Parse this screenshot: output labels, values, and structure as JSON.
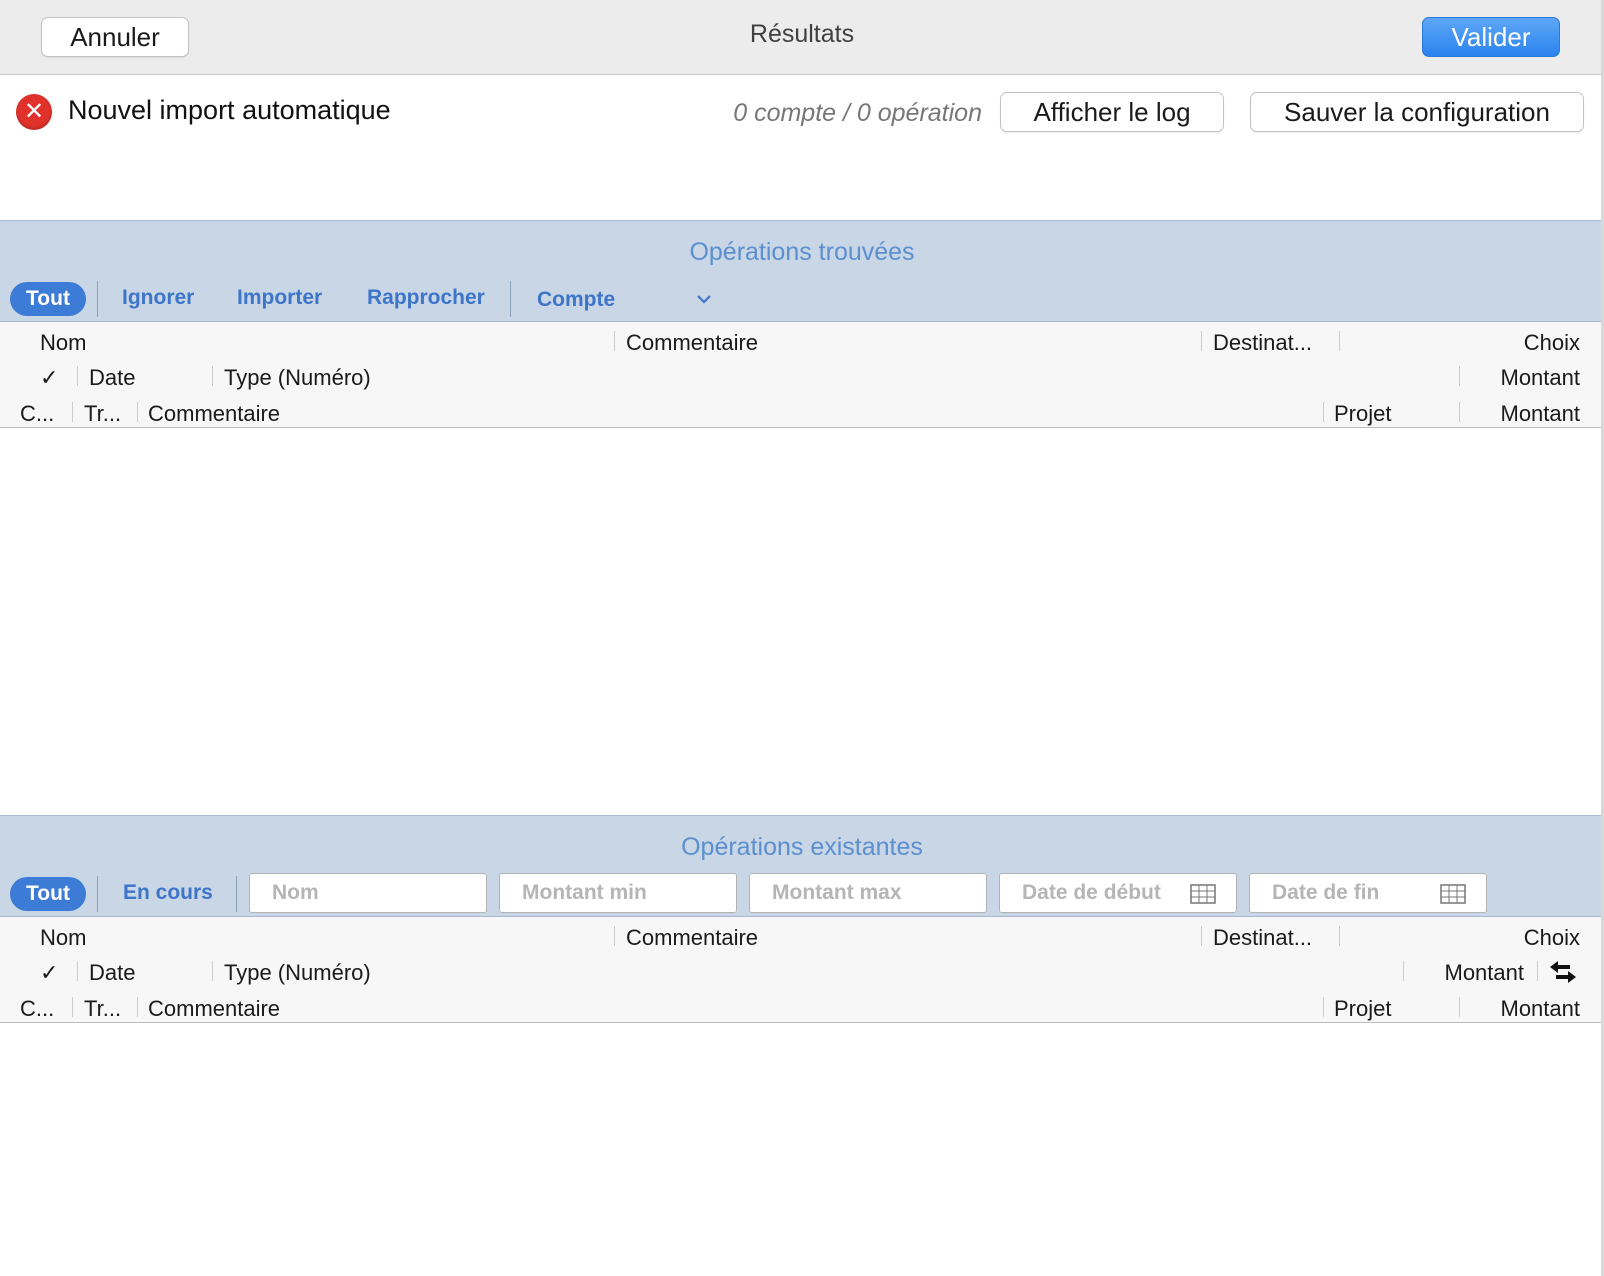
{
  "window": {
    "title": "Résultats",
    "cancel_label": "Annuler",
    "validate_label": "Valider",
    "accent_color": "#2b83ee"
  },
  "import": {
    "status_icon": "error-circle-icon",
    "title": "Nouvel import automatique",
    "counts": "0 compte / 0 opération",
    "show_log_label": "Afficher le log",
    "save_config_label": "Sauver la configuration"
  },
  "found": {
    "title": "Opérations trouvées",
    "filters": [
      "Tout",
      "Ignorer",
      "Importer",
      "Rapprocher"
    ],
    "account_label": "Compte",
    "columns": {
      "row1": [
        "Nom",
        "Commentaire",
        "Destinat...",
        "Choix"
      ],
      "row2": [
        "✓",
        "Date",
        "Type (Numéro)",
        "Montant"
      ],
      "row3": [
        "C...",
        "Tr...",
        "Commentaire",
        "Projet",
        "Montant"
      ]
    }
  },
  "existing": {
    "title": "Opérations existantes",
    "filters": [
      "Tout",
      "En cours"
    ],
    "fields": {
      "name_placeholder": "Nom",
      "min_placeholder": "Montant min",
      "max_placeholder": "Montant max",
      "start_placeholder": "Date de début",
      "end_placeholder": "Date de fin"
    },
    "columns": {
      "row1": [
        "Nom",
        "Commentaire",
        "Destinat...",
        "Choix"
      ],
      "row2": [
        "✓",
        "Date",
        "Type (Numéro)",
        "Montant"
      ],
      "row3": [
        "C...",
        "Tr...",
        "Commentaire",
        "Projet",
        "Montant"
      ]
    }
  }
}
